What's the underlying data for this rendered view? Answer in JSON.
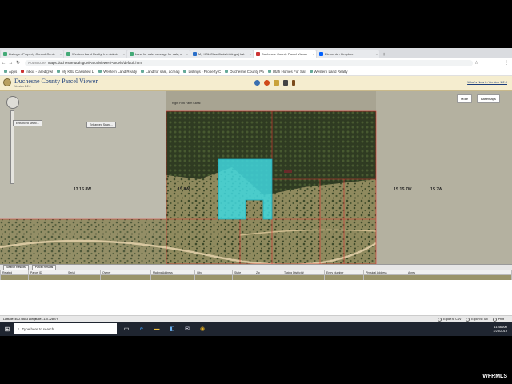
{
  "browser": {
    "tabs": [
      {
        "label": "Listings - Property Control Cente",
        "active": false
      },
      {
        "label": "Western Land Realty, Inc. Admin",
        "active": false
      },
      {
        "label": "Land for sale, acreage for sale, c",
        "active": false
      },
      {
        "label": "My KSL Classifieds Listings | ksl.",
        "active": false
      },
      {
        "label": "Duchesne County Parcel Viewer",
        "active": true
      },
      {
        "label": "Elements - Dropbox",
        "active": false
      }
    ],
    "new_tab": "+",
    "security_label": "Not secure",
    "url": "maps.duchesne.utah.gov/Parcelviewer/Parcels/default.htm",
    "bookmarks": [
      "Apps",
      "Inbox - jared@wl",
      "My KSL Classified Li",
      "Western Land Realty",
      "Land for sale, acreag",
      "Listings - Property C",
      "Duchesne County Pa",
      "Utah Homes For Sal",
      "Western Land Realty"
    ]
  },
  "app": {
    "title": "Duchesne County Parcel Viewer",
    "version": "Version 1.2.0",
    "whats_new": "What's New in Version 1.2.0"
  },
  "map": {
    "buttons": {
      "more": "More",
      "basemaps": "Basemaps"
    },
    "callouts": [
      "Enhanced Searc...",
      "Enhanced Searc..."
    ],
    "road_label": "Right Fork Farm Canal",
    "labels": [
      "13 1S 8W",
      "1S 8W",
      "1S 1S 7W",
      "1S 7W"
    ],
    "colors": {
      "parcel_highlight": "#3fd7de",
      "parcel_line": "#e03030"
    }
  },
  "results": {
    "tabs": [
      "Search Results",
      "Parcel Results"
    ],
    "columns": [
      "Related",
      "Parcel ID",
      "Serial",
      "Owner",
      "Mailing Address",
      "City",
      "State",
      "Zip",
      "Taxing District #",
      "Entry Number",
      "Physical Address",
      "Acres"
    ],
    "rows": [
      [
        "",
        "",
        "",
        "",
        "",
        "",
        "",
        "",
        "",
        "",
        "",
        ""
      ]
    ]
  },
  "status": {
    "coords": "Latitude: 40.275603   Longitude: -110.728079",
    "options": [
      "Export to CSV",
      "Export to Tax",
      "Print"
    ]
  },
  "taskbar": {
    "search_placeholder": "Type here to search",
    "time": "11:46 AM",
    "date": "1/25/2019"
  },
  "watermark": "WFRMLS"
}
